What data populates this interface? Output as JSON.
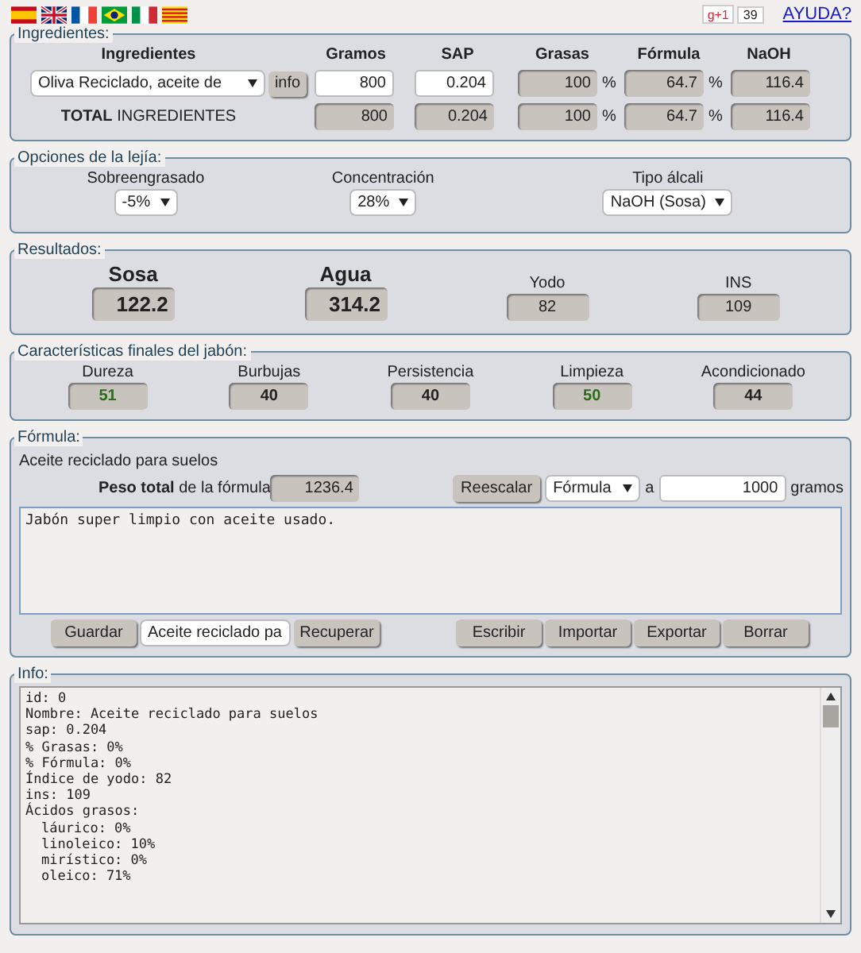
{
  "header": {
    "gplus": {
      "label": "g+1",
      "count": "39"
    },
    "help_link": "AYUDA?"
  },
  "ingredients": {
    "legend": "Ingredientes:",
    "name_column": "Ingredientes",
    "columns": [
      "Gramos",
      "SAP",
      "Grasas",
      "Fórmula",
      "NaOH"
    ],
    "rows": [
      {
        "kind": "ingredient",
        "name": "Oliva Reciclado, aceite de",
        "button": "info",
        "cells": [
          {
            "value": "800",
            "editable": true
          },
          {
            "value": "0.204",
            "editable": true
          },
          {
            "value": "100",
            "editable": false,
            "unit": "%"
          },
          {
            "value": "64.7",
            "editable": false,
            "unit": "%"
          },
          {
            "value": "116.4",
            "editable": false
          }
        ]
      },
      {
        "kind": "total",
        "name": "**TOTAL** INGREDIENTES",
        "cells": [
          {
            "value": "800",
            "editable": false
          },
          {
            "value": "0.204",
            "editable": false
          },
          {
            "value": "100",
            "editable": false,
            "unit": "%"
          },
          {
            "value": "64.7",
            "editable": false,
            "unit": "%"
          },
          {
            "value": "116.4",
            "editable": false
          }
        ]
      }
    ]
  },
  "lye": {
    "legend": "Opciones de la lejía:",
    "options": [
      {
        "label": "Sobreengrasado",
        "value": "-5%"
      },
      {
        "label": "Concentración",
        "value": "28%"
      },
      {
        "label": "Tipo álcali",
        "value": "NaOH (Sosa)"
      }
    ]
  },
  "results": {
    "legend": "Resultados:",
    "main": [
      {
        "label": "Sosa",
        "value": "122.2"
      },
      {
        "label": "Agua",
        "value": "314.2"
      }
    ],
    "minor": [
      {
        "label": "Yodo",
        "value": "82"
      },
      {
        "label": "INS",
        "value": "109"
      }
    ]
  },
  "characteristics": {
    "legend": "Características finales del jabón:",
    "items": [
      {
        "label": "Dureza",
        "value": "51",
        "color": "#2e6b1e"
      },
      {
        "label": "Burbujas",
        "value": "40",
        "color": "#222222"
      },
      {
        "label": "Persistencia",
        "value": "40",
        "color": "#222222"
      },
      {
        "label": "Limpieza",
        "value": "50",
        "color": "#2e6b1e"
      },
      {
        "label": "Acondicionado",
        "value": "44",
        "color": "#222222"
      }
    ]
  },
  "formula": {
    "legend": "Fórmula:",
    "name": "Aceite reciclado para suelos",
    "total_label": "**Peso total** de la fórmula",
    "total_value": "1236.4",
    "rescale_button": "Reescalar",
    "rescale_select": "Fórmula",
    "to_label": "a",
    "rescale_amount": "1000",
    "unit": "gramos",
    "notes": "Jabón super limpio con aceite usado.",
    "save_button": "Guardar",
    "saved_select": "Aceite reciclado pa",
    "load_button": "Recuperar",
    "actions": [
      "Escribir",
      "Importar",
      "Exportar",
      "Borrar"
    ]
  },
  "info": {
    "legend": "Info:",
    "lines": [
      {
        "text": "id: 0"
      },
      {
        "text": "Nombre: Aceite reciclado para suelos"
      },
      {
        "text": "sap: 0.204"
      },
      {
        "text": "% Grasas: 0%"
      },
      {
        "text": "% Fórmula: 0%"
      },
      {
        "text": "Índice de yodo: 82"
      },
      {
        "text": "ins: 109"
      },
      {
        "text": "Ácidos grasos:",
        "children": [
          {
            "text": "láurico: 0%"
          },
          {
            "text": "linoleico: 10%"
          },
          {
            "text": "mirístico: 0%"
          },
          {
            "text": "oleico: 71%"
          }
        ]
      }
    ]
  }
}
